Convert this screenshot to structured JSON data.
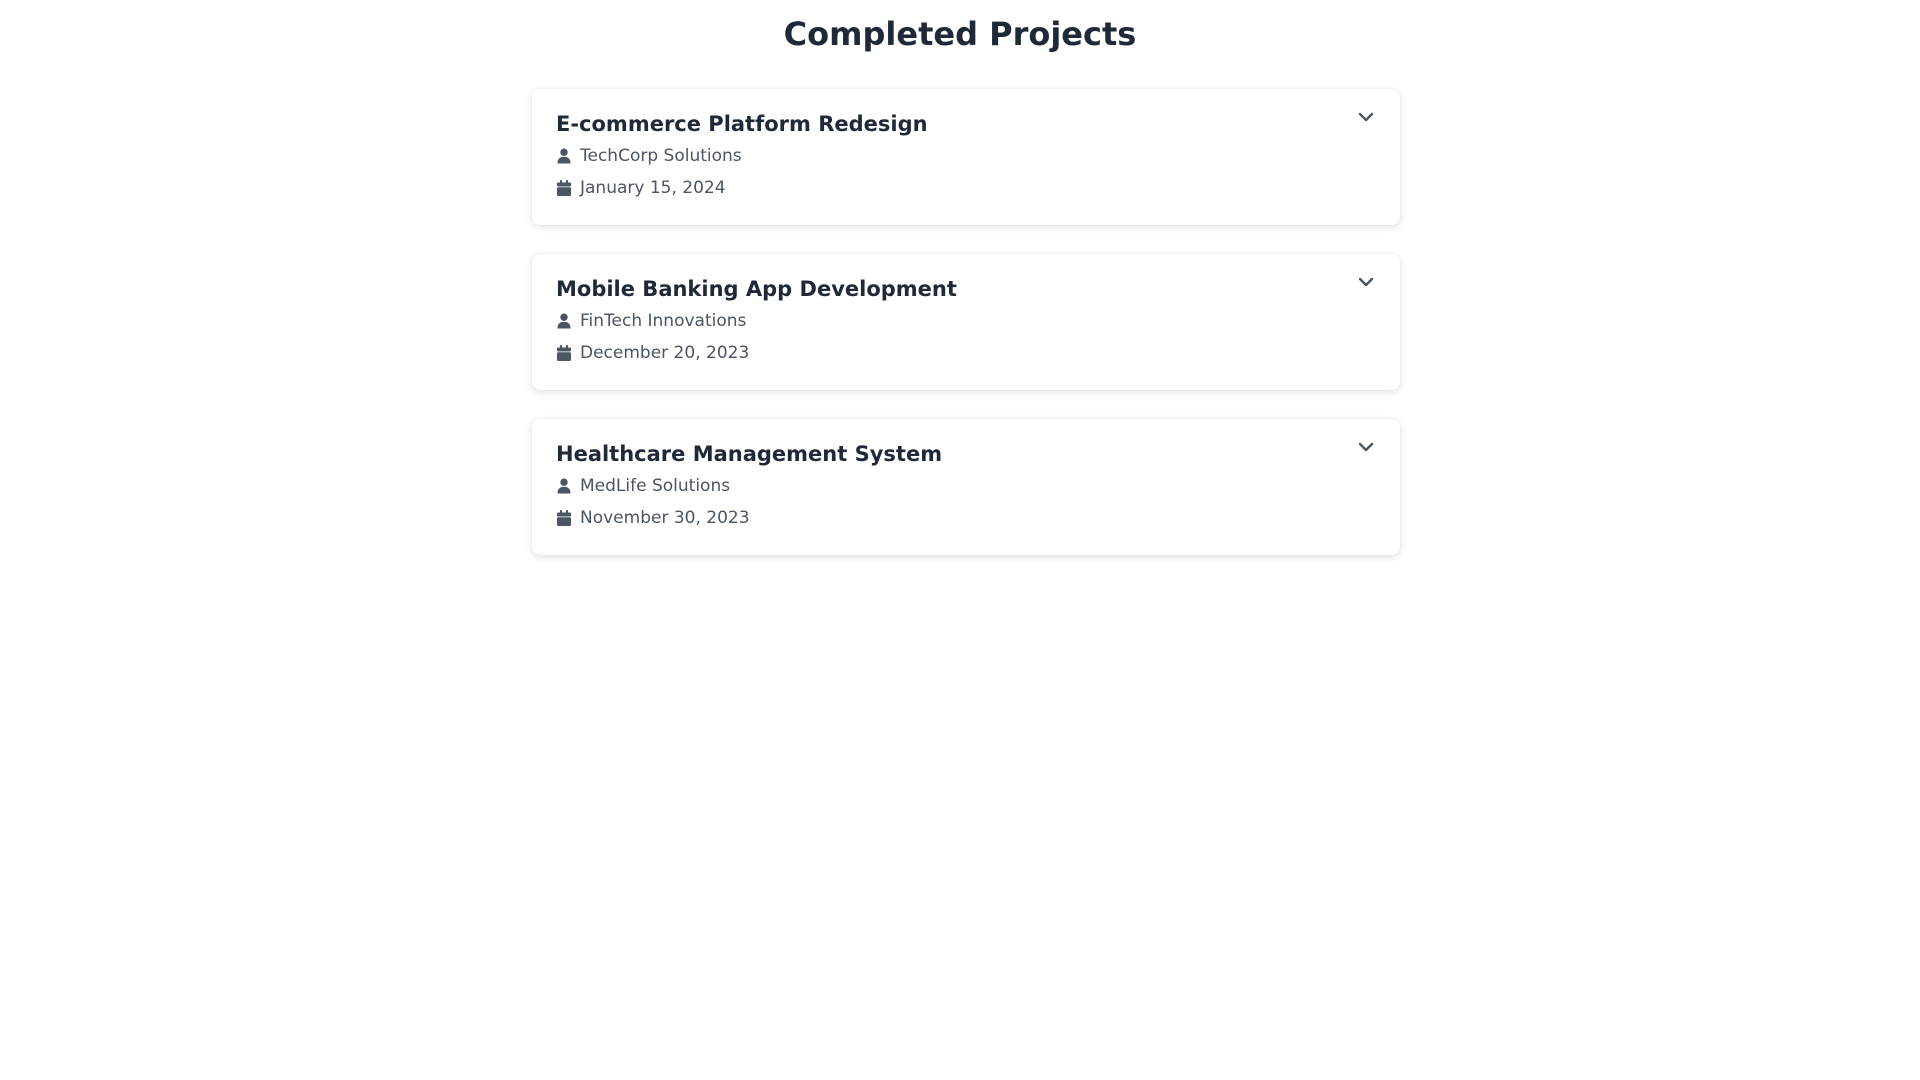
{
  "page": {
    "title": "Completed Projects"
  },
  "projects": [
    {
      "title": "E-commerce Platform Redesign",
      "client": "TechCorp Solutions",
      "date": "January 15, 2024"
    },
    {
      "title": "Mobile Banking App Development",
      "client": "FinTech Innovations",
      "date": "December 20, 2023"
    },
    {
      "title": "Healthcare Management System",
      "client": "MedLife Solutions",
      "date": "November 30, 2023"
    }
  ],
  "icons": {
    "client": "user-icon",
    "date": "calendar-icon",
    "toggle": "chevron-down-icon"
  },
  "colors": {
    "title_text": "#1f2937",
    "meta_text": "#4b5563",
    "icon": "#4b5563",
    "card_background": "#ffffff"
  }
}
